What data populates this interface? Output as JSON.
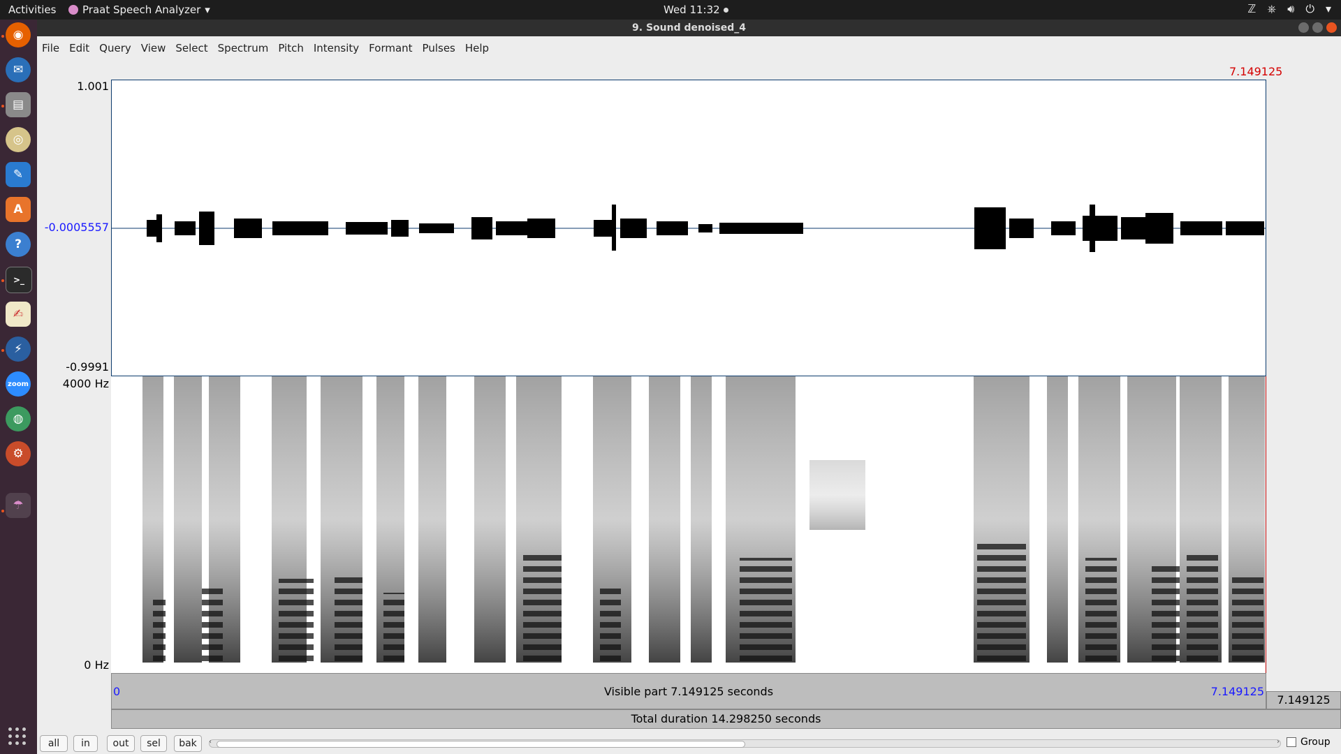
{
  "topbar": {
    "activities": "Activities",
    "app_name": "Praat Speech Analyzer",
    "clock": "Wed 11:32"
  },
  "window": {
    "title": "9. Sound denoised_4"
  },
  "menu": [
    "File",
    "Edit",
    "Query",
    "View",
    "Select",
    "Spectrum",
    "Pitch",
    "Intensity",
    "Formant",
    "Pulses",
    "Help"
  ],
  "editor": {
    "cursor_time": "7.149125",
    "wave_max": "1.001",
    "wave_zero": "-0.0005557",
    "wave_min": "-0.9991",
    "spec_max": "4000 Hz",
    "spec_min": "0 Hz",
    "visible_start": "0",
    "visible_label": "Visible part 7.149125 seconds",
    "visible_end": "7.149125",
    "right_value": "7.149125",
    "total_label": "Total duration 14.298250 seconds"
  },
  "buttons": {
    "all": "all",
    "in": "in",
    "out": "out",
    "sel": "sel",
    "bak": "bak"
  },
  "group_label": "Group",
  "dock": [
    "firefox",
    "thunderbird",
    "files",
    "rhythmbox",
    "libreoffice-writer",
    "software-center",
    "help",
    "terminal",
    "text-editor",
    "kodi",
    "zoom",
    "browser",
    "settings",
    "praat"
  ]
}
